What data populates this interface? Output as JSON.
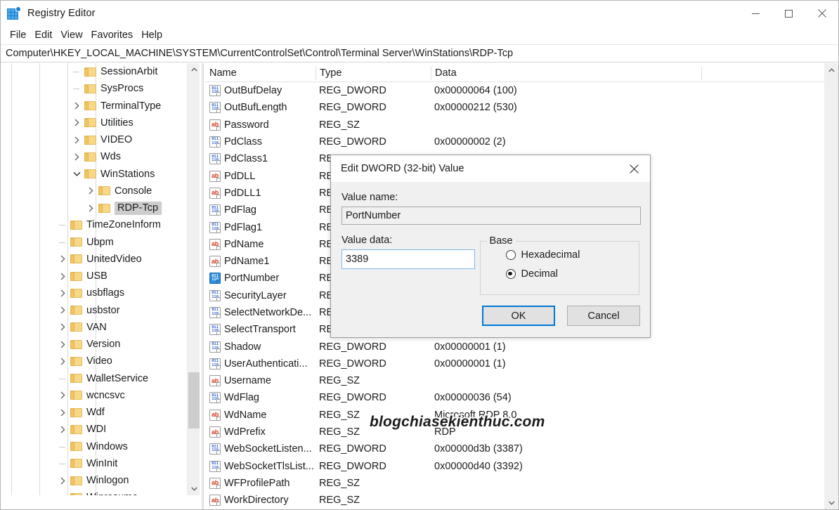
{
  "window": {
    "title": "Registry Editor",
    "icon": "registry-editor-icon",
    "controls": {
      "minimize": "minimize-icon",
      "maximize": "maximize-icon",
      "close": "close-icon"
    }
  },
  "menubar": {
    "items": [
      "File",
      "Edit",
      "View",
      "Favorites",
      "Help"
    ]
  },
  "address": {
    "path": "Computer\\HKEY_LOCAL_MACHINE\\SYSTEM\\CurrentControlSet\\Control\\Terminal Server\\WinStations\\RDP-Tcp"
  },
  "tree": {
    "items": [
      {
        "label": "SessionArbit",
        "indent": 5,
        "twist": "none",
        "selected": false
      },
      {
        "label": "SysProcs",
        "indent": 5,
        "twist": "none",
        "selected": false
      },
      {
        "label": "TerminalType",
        "indent": 5,
        "twist": "collapsed",
        "selected": false
      },
      {
        "label": "Utilities",
        "indent": 5,
        "twist": "collapsed",
        "selected": false
      },
      {
        "label": "VIDEO",
        "indent": 5,
        "twist": "collapsed",
        "selected": false
      },
      {
        "label": "Wds",
        "indent": 5,
        "twist": "collapsed",
        "selected": false
      },
      {
        "label": "WinStations",
        "indent": 5,
        "twist": "expanded",
        "selected": false
      },
      {
        "label": "Console",
        "indent": 6,
        "twist": "collapsed",
        "selected": false
      },
      {
        "label": "RDP-Tcp",
        "indent": 6,
        "twist": "collapsed",
        "selected": true
      },
      {
        "label": "TimeZoneInform",
        "indent": 4,
        "twist": "none",
        "selected": false
      },
      {
        "label": "Ubpm",
        "indent": 4,
        "twist": "none",
        "selected": false
      },
      {
        "label": "UnitedVideo",
        "indent": 4,
        "twist": "collapsed",
        "selected": false
      },
      {
        "label": "USB",
        "indent": 4,
        "twist": "collapsed",
        "selected": false
      },
      {
        "label": "usbflags",
        "indent": 4,
        "twist": "collapsed",
        "selected": false
      },
      {
        "label": "usbstor",
        "indent": 4,
        "twist": "collapsed",
        "selected": false
      },
      {
        "label": "VAN",
        "indent": 4,
        "twist": "collapsed",
        "selected": false
      },
      {
        "label": "Version",
        "indent": 4,
        "twist": "collapsed",
        "selected": false
      },
      {
        "label": "Video",
        "indent": 4,
        "twist": "collapsed",
        "selected": false
      },
      {
        "label": "WalletService",
        "indent": 4,
        "twist": "none",
        "selected": false
      },
      {
        "label": "wcncsvc",
        "indent": 4,
        "twist": "collapsed",
        "selected": false
      },
      {
        "label": "Wdf",
        "indent": 4,
        "twist": "collapsed",
        "selected": false
      },
      {
        "label": "WDI",
        "indent": 4,
        "twist": "collapsed",
        "selected": false
      },
      {
        "label": "Windows",
        "indent": 4,
        "twist": "none",
        "selected": false
      },
      {
        "label": "WinInit",
        "indent": 4,
        "twist": "none",
        "selected": false
      },
      {
        "label": "Winlogon",
        "indent": 4,
        "twist": "collapsed",
        "selected": false
      },
      {
        "label": "Winresume",
        "indent": 4,
        "twist": "none",
        "selected": false
      }
    ],
    "scroll_up_icon": "chevron-up-icon",
    "scroll_down_icon": "chevron-down-icon",
    "scroll_left_icon": "chevron-left-icon",
    "scroll_right_icon": "chevron-right-icon"
  },
  "list": {
    "columns": [
      "Name",
      "Type",
      "Data"
    ],
    "rows": [
      {
        "name": "OutBufDelay",
        "type": "REG_DWORD",
        "data": "0x00000064 (100)",
        "icon": "dword",
        "selected": false
      },
      {
        "name": "OutBufLength",
        "type": "REG_DWORD",
        "data": "0x00000212 (530)",
        "icon": "dword",
        "selected": false
      },
      {
        "name": "Password",
        "type": "REG_SZ",
        "data": "",
        "icon": "sz",
        "selected": false
      },
      {
        "name": "PdClass",
        "type": "REG_DWORD",
        "data": "0x00000002 (2)",
        "icon": "dword",
        "selected": false
      },
      {
        "name": "PdClass1",
        "type": "REG_DWORD",
        "data": "",
        "icon": "dword",
        "selected": false
      },
      {
        "name": "PdDLL",
        "type": "REG_SZ",
        "data": "",
        "icon": "sz",
        "selected": false
      },
      {
        "name": "PdDLL1",
        "type": "REG_SZ",
        "data": "",
        "icon": "sz",
        "selected": false
      },
      {
        "name": "PdFlag",
        "type": "REG_DWORD",
        "data": "",
        "icon": "dword",
        "selected": false
      },
      {
        "name": "PdFlag1",
        "type": "REG_DWORD",
        "data": "",
        "icon": "dword",
        "selected": false
      },
      {
        "name": "PdName",
        "type": "REG_SZ",
        "data": "",
        "icon": "sz",
        "selected": false
      },
      {
        "name": "PdName1",
        "type": "REG_SZ",
        "data": "",
        "icon": "sz",
        "selected": false
      },
      {
        "name": "PortNumber",
        "type": "REG_DWORD",
        "data": "",
        "icon": "dword",
        "selected": true
      },
      {
        "name": "SecurityLayer",
        "type": "REG_DWORD",
        "data": "",
        "icon": "dword",
        "selected": false
      },
      {
        "name": "SelectNetworkDe...",
        "type": "REG_DWORD",
        "data": "",
        "icon": "dword",
        "selected": false
      },
      {
        "name": "SelectTransport",
        "type": "REG_DWORD",
        "data": "",
        "icon": "dword",
        "selected": false
      },
      {
        "name": "Shadow",
        "type": "REG_DWORD",
        "data": "0x00000001 (1)",
        "icon": "dword",
        "selected": false
      },
      {
        "name": "UserAuthenticati...",
        "type": "REG_DWORD",
        "data": "0x00000001 (1)",
        "icon": "dword",
        "selected": false
      },
      {
        "name": "Username",
        "type": "REG_SZ",
        "data": "",
        "icon": "sz",
        "selected": false
      },
      {
        "name": "WdFlag",
        "type": "REG_DWORD",
        "data": "0x00000036 (54)",
        "icon": "dword",
        "selected": false
      },
      {
        "name": "WdName",
        "type": "REG_SZ",
        "data": "Microsoft RDP 8.0",
        "icon": "sz",
        "selected": false
      },
      {
        "name": "WdPrefix",
        "type": "REG_SZ",
        "data": "RDP",
        "icon": "sz",
        "selected": false
      },
      {
        "name": "WebSocketListen...",
        "type": "REG_DWORD",
        "data": "0x00000d3b (3387)",
        "icon": "dword",
        "selected": false
      },
      {
        "name": "WebSocketTlsList...",
        "type": "REG_DWORD",
        "data": "0x00000d40 (3392)",
        "icon": "dword",
        "selected": false
      },
      {
        "name": "WFProfilePath",
        "type": "REG_SZ",
        "data": "",
        "icon": "sz",
        "selected": false
      },
      {
        "name": "WorkDirectory",
        "type": "REG_SZ",
        "data": "",
        "icon": "sz",
        "selected": false
      }
    ],
    "scroll_up_icon": "chevron-up-icon",
    "scroll_down_icon": "chevron-down-icon"
  },
  "dialog": {
    "title": "Edit DWORD (32-bit) Value",
    "close_icon": "close-icon",
    "value_name_label": "Value name:",
    "value_name": "PortNumber",
    "value_data_label": "Value data:",
    "value_data": "3389",
    "base_label": "Base",
    "base_options": [
      {
        "label": "Hexadecimal",
        "selected": false
      },
      {
        "label": "Decimal",
        "selected": true
      }
    ],
    "ok_label": "OK",
    "cancel_label": "Cancel",
    "focus_color": "#0078d7"
  },
  "watermark": {
    "text": "blogchiasekienthuc.com"
  }
}
